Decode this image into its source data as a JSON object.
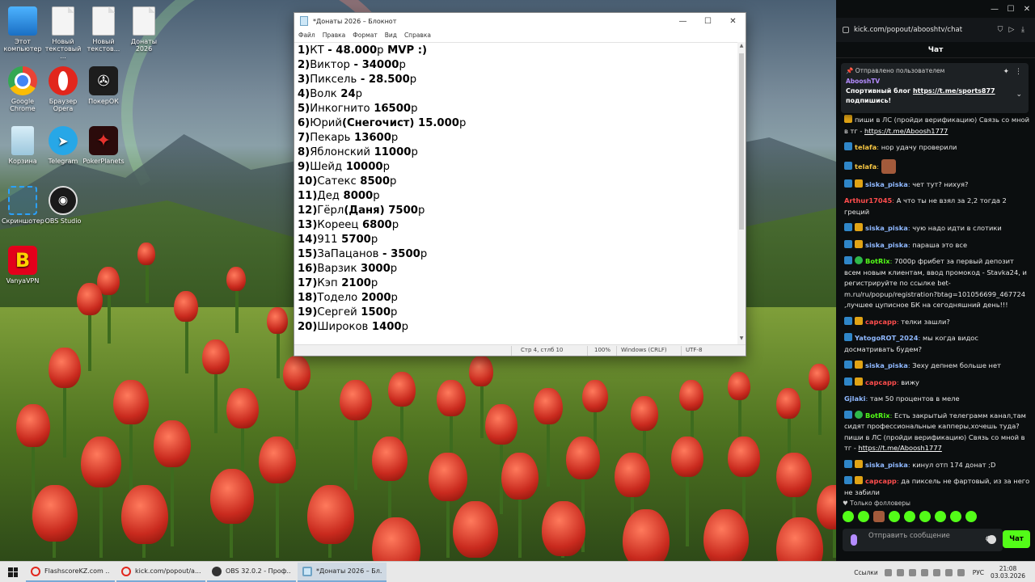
{
  "desktop": {
    "icons": [
      {
        "label": "Этот компьютер",
        "icon": "computer-icon"
      },
      {
        "label": "Новый текстовый ...",
        "icon": "text-file-icon"
      },
      {
        "label": "Новый текстов...",
        "icon": "text-file-icon"
      },
      {
        "label": "Донаты 2026",
        "icon": "text-file-icon"
      },
      {
        "label": "Google Chrome",
        "icon": "chrome-icon"
      },
      {
        "label": "Браузер Opera",
        "icon": "opera-icon"
      },
      {
        "label": "ПокерОК",
        "icon": "pokerok-icon"
      },
      {
        "label": "Корзина",
        "icon": "recycle-bin-icon"
      },
      {
        "label": "Telegram",
        "icon": "telegram-icon"
      },
      {
        "label": "PokerPlanets",
        "icon": "pokerplanets-icon"
      },
      {
        "label": "Скриншотер",
        "icon": "screenshot-icon"
      },
      {
        "label": "OBS Studio",
        "icon": "obs-icon"
      },
      {
        "label": "VanyaVPN",
        "icon": "vpn-icon"
      }
    ]
  },
  "notepad": {
    "title": "*Донаты 2026 – Блокнот",
    "menu": [
      "Файл",
      "Правка",
      "Формат",
      "Вид",
      "Справка"
    ],
    "lines": [
      {
        "num": "1)",
        "name": "КТ",
        "amount": " - 48.000",
        "suffix": "р",
        "extra": " MVP :)"
      },
      {
        "num": "2)",
        "name": "Виктор",
        "amount": " - 34000",
        "suffix": "р",
        "extra": ""
      },
      {
        "num": "3)",
        "name": "Пиксель",
        "amount": " - 28.500",
        "suffix": "р",
        "extra": ""
      },
      {
        "num": "4)",
        "name": "Волк",
        "amount": " 24",
        "suffix": "р",
        "extra": ""
      },
      {
        "num": "5)",
        "name": "Инкогнито",
        "amount": " 16500",
        "suffix": "р",
        "extra": ""
      },
      {
        "num": "6)",
        "name": "Юрий",
        "amount": "(Снегочист) 15.000",
        "suffix": "р",
        "extra": ""
      },
      {
        "num": "7)",
        "name": "Пекарь",
        "amount": " 13600",
        "suffix": "р",
        "extra": ""
      },
      {
        "num": "8)",
        "name": "Яблонский",
        "amount": " 11000",
        "suffix": "р",
        "extra": ""
      },
      {
        "num": "9)",
        "name": "Шейд",
        "amount": " 10000",
        "suffix": "р",
        "extra": ""
      },
      {
        "num": "10)",
        "name": "Сатекс",
        "amount": " 8500",
        "suffix": "р",
        "extra": ""
      },
      {
        "num": "11)",
        "name": "Дед",
        "amount": " 8000",
        "suffix": "р",
        "extra": ""
      },
      {
        "num": "12)",
        "name": "Гёрл",
        "amount": "(Даня) 7500",
        "suffix": "р",
        "extra": ""
      },
      {
        "num": "13)",
        "name": "Кореец",
        "amount": " 6800",
        "suffix": "р",
        "extra": ""
      },
      {
        "num": "14)",
        "name": "911",
        "amount": " 5700",
        "suffix": "р",
        "extra": ""
      },
      {
        "num": "15)",
        "name": "ЗаПацанов",
        "amount": " - 3500",
        "suffix": "р",
        "extra": ""
      },
      {
        "num": "16)",
        "name": "Варзик",
        "amount": " 3000",
        "suffix": "р",
        "extra": ""
      },
      {
        "num": "17)",
        "name": "Кэп",
        "amount": " 2100",
        "suffix": "р",
        "extra": ""
      },
      {
        "num": "18)",
        "name": "Тодело",
        "amount": " 2000",
        "suffix": "р",
        "extra": ""
      },
      {
        "num": "19)",
        "name": "Сергей",
        "amount": " 1500",
        "suffix": "р",
        "extra": ""
      },
      {
        "num": "20)",
        "name": "Широков",
        "amount": " 1400",
        "suffix": "р",
        "extra": ""
      }
    ],
    "status": {
      "position": "Стр 4, стлб 10",
      "zoom": "100%",
      "line_ending": "Windows (CRLF)",
      "encoding": "UTF-8"
    }
  },
  "browser": {
    "url": "kick.com/popout/abooshtv/chat",
    "chat_title": "Чат",
    "pinned": {
      "header": "Отправлено пользователем",
      "user": "AbooshTV",
      "text_prefix": "Спортивный блог ",
      "link": "https://t.me/sports877",
      "text_suffix": " подпишись!"
    },
    "messages": [
      {
        "badges": [
          "crown"
        ],
        "user": "",
        "user_color": "#ffffff",
        "text": "пиши в ЛС (пройди верификацию) Связь со мной в тг - ",
        "link": "https://t.me/Aboosh1777"
      },
      {
        "badges": [
          "sub"
        ],
        "user": "telafa",
        "user_color": "#f5c542",
        "text": "нор удачу проверили",
        "link": ""
      },
      {
        "badges": [
          "sub"
        ],
        "user": "telafa",
        "user_color": "#f5c542",
        "text": "",
        "link": "",
        "emote": true
      },
      {
        "badges": [
          "sub",
          "crown"
        ],
        "user": "siska_piska",
        "user_color": "#8fb8ff",
        "text": "чет тут? нихуя?",
        "link": ""
      },
      {
        "badges": [],
        "user": "Arthur17045",
        "user_color": "#ff4d4d",
        "text": "А что ты не взял за 2,2 тогда 2 греций",
        "link": ""
      },
      {
        "badges": [
          "sub",
          "crown"
        ],
        "user": "siska_piska",
        "user_color": "#8fb8ff",
        "text": "чую надо идти в слотики",
        "link": ""
      },
      {
        "badges": [
          "sub",
          "crown"
        ],
        "user": "siska_piska",
        "user_color": "#8fb8ff",
        "text": "параша это все",
        "link": ""
      },
      {
        "badges": [
          "sub",
          "verified"
        ],
        "user": "BotRix",
        "user_color": "#53fc18",
        "text": "7000р фрибет за первый депозит всем новым клиентам, ввод промокод - Stavka24, и регистрируйте по ссылке bet-m.ru/ru/popup/registration?btag=101056699_467724 ,лучшее цуписное БК на сегодняшний день!!!",
        "link": ""
      },
      {
        "badges": [
          "sub",
          "crown"
        ],
        "user": "сарсарр",
        "user_color": "#ff4d4d",
        "text": "телки зашли?",
        "link": ""
      },
      {
        "badges": [
          "sub"
        ],
        "user": "YatogoROT_2024",
        "user_color": "#8fb8ff",
        "text": "мы когда видос досматривать будем?",
        "link": ""
      },
      {
        "badges": [
          "sub",
          "crown"
        ],
        "user": "siska_piska",
        "user_color": "#8fb8ff",
        "text": "Зеху депнем больше нет",
        "link": ""
      },
      {
        "badges": [
          "sub",
          "crown"
        ],
        "user": "сарсарр",
        "user_color": "#ff4d4d",
        "text": "вижу",
        "link": ""
      },
      {
        "badges": [],
        "user": "Gjlaki",
        "user_color": "#8fb8ff",
        "text": "там 50 процентов в меле",
        "link": ""
      },
      {
        "badges": [
          "sub",
          "verified"
        ],
        "user": "BotRix",
        "user_color": "#53fc18",
        "text": "Есть закрытый телеграмм канал,там сидят профессиональные капперы,хочешь туда? пиши в ЛС (пройди верификацию) Связь со мной в тг - ",
        "link": "https://t.me/Aboosh1777"
      },
      {
        "badges": [
          "sub",
          "crown"
        ],
        "user": "siska_piska",
        "user_color": "#8fb8ff",
        "text": "кинул отп 174 донат ;D",
        "link": ""
      },
      {
        "badges": [
          "sub",
          "crown"
        ],
        "user": "сарсарр",
        "user_color": "#ff4d4d",
        "text": "да пиксель не фартовый, из за него не забили",
        "link": ""
      }
    ],
    "followers_only": "Только фолловеры",
    "input_placeholder": "Отправить сообщение",
    "send_label": "Чат"
  },
  "taskbar": {
    "tasks": [
      {
        "label": "FlashscoreKZ.com ...",
        "icon": "opera-icon",
        "active": false
      },
      {
        "label": "kick.com/popout/a...",
        "icon": "opera-icon",
        "active": false
      },
      {
        "label": "OBS 32.0.2 - Проф...",
        "icon": "obs-icon",
        "active": false
      },
      {
        "label": "*Донаты 2026 – Бл...",
        "icon": "notepad-icon",
        "active": true
      }
    ],
    "tray": {
      "links": "Ссылки",
      "lang": "РУС",
      "time": "21:08",
      "date": "03.03.2026"
    }
  },
  "colors": {
    "kick_green": "#53fc18",
    "chat_bg": "#0b0e0f",
    "pinned_user": "#b48cff"
  }
}
